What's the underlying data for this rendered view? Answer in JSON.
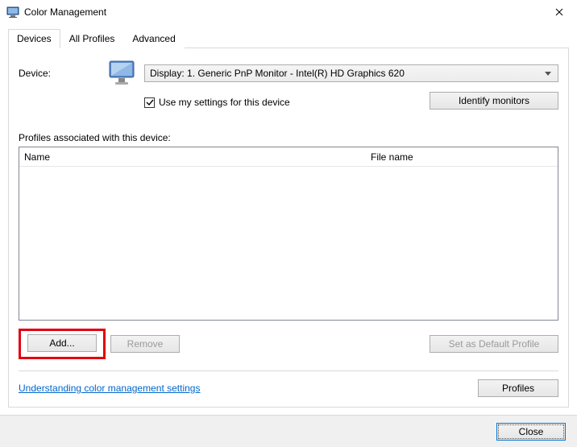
{
  "window": {
    "title": "Color Management"
  },
  "tabs": {
    "devices": "Devices",
    "allProfiles": "All Profiles",
    "advanced": "Advanced"
  },
  "device": {
    "label": "Device:",
    "selected": "Display: 1. Generic PnP Monitor - Intel(R) HD Graphics 620",
    "useMySettings": "Use my settings for this device",
    "identify": "Identify monitors"
  },
  "profiles": {
    "sectionLabel": "Profiles associated with this device:",
    "cols": {
      "name": "Name",
      "file": "File name"
    }
  },
  "buttons": {
    "add": "Add...",
    "remove": "Remove",
    "setDefault": "Set as Default Profile",
    "profiles": "Profiles",
    "close": "Close"
  },
  "link": {
    "understanding": "Understanding color management settings"
  }
}
